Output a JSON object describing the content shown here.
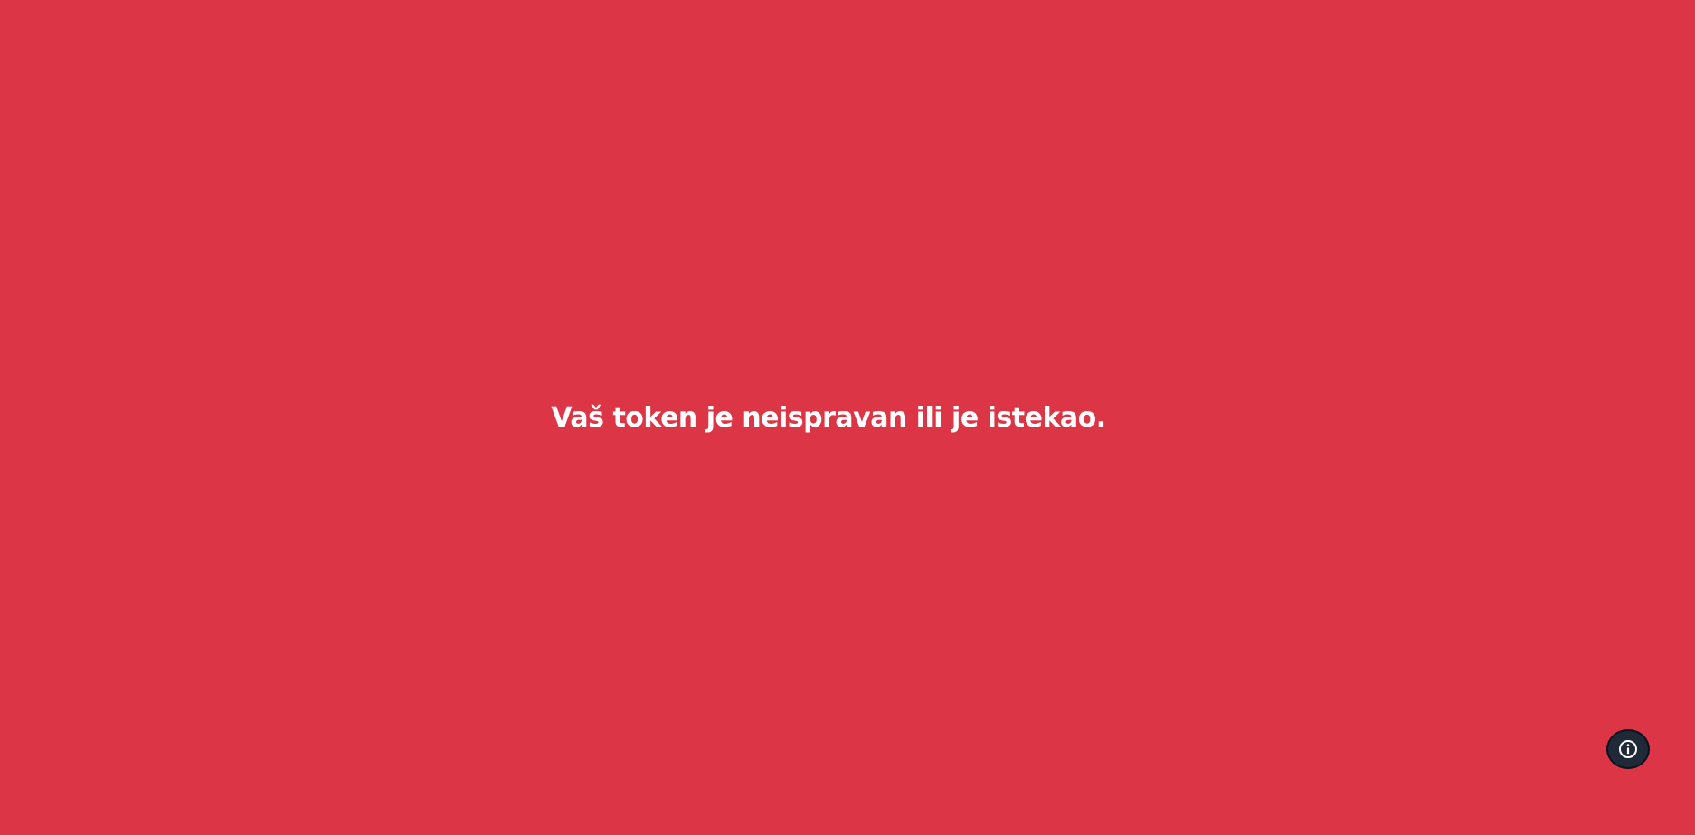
{
  "page": {
    "background_color": "#dc3545"
  },
  "message": {
    "text": "Vaš token je neispravan ili je istekao.",
    "color": "#ffffff"
  },
  "info_button": {
    "icon": "info-icon",
    "background_color": "#1f2937"
  }
}
